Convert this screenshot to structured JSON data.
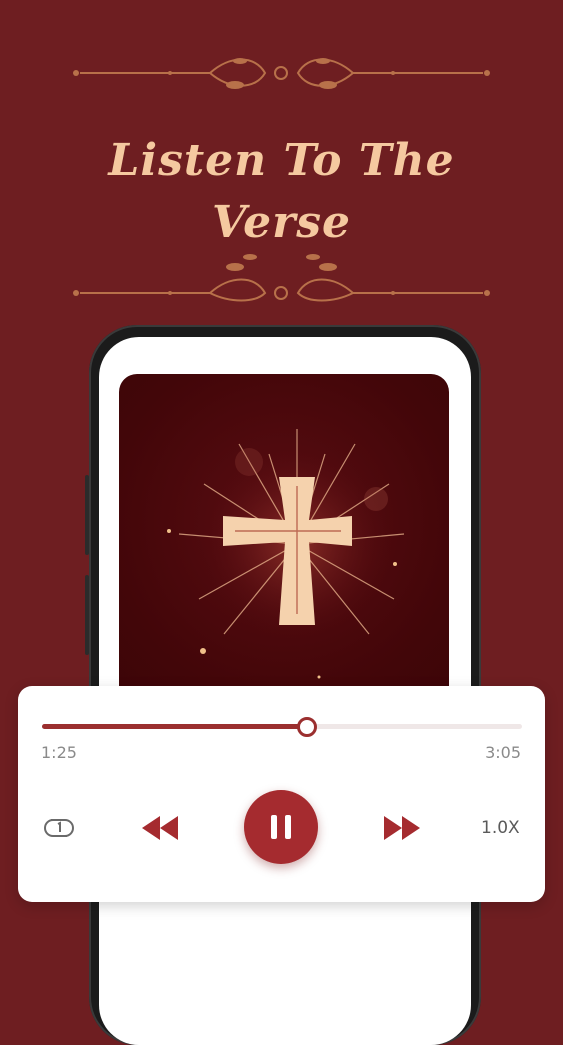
{
  "promo": {
    "headline_line1": "Listen To The",
    "headline_line2": "Verse"
  },
  "player": {
    "elapsed": "1:25",
    "duration": "3:05",
    "progress_fraction": 0.553,
    "speed": "1.0X",
    "state": "playing"
  },
  "icons": {
    "loop": "repeat-one-icon",
    "rewind": "rewind-icon",
    "pause": "pause-icon",
    "forward": "fast-forward-icon"
  },
  "colors": {
    "background": "#6e1e21",
    "accent": "#9b2f2f",
    "headline": "#f5c9a0",
    "cross": "#f5d2ad"
  }
}
